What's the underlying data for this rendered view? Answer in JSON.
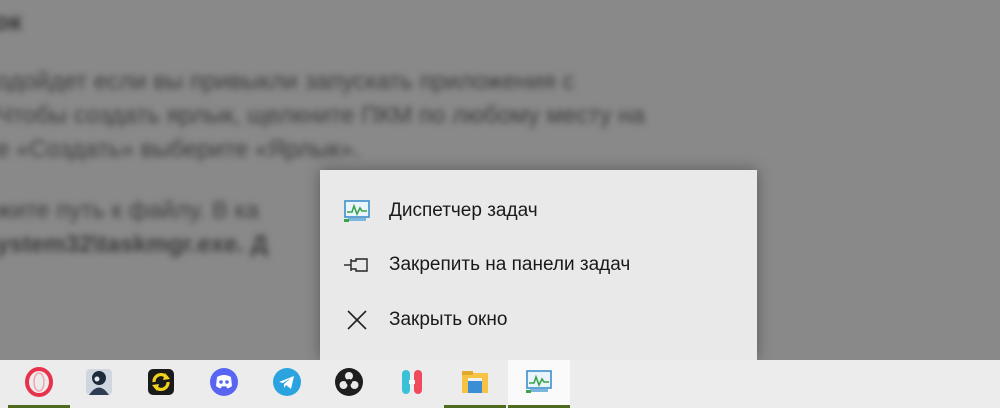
{
  "background_document": {
    "heading": "ок",
    "lines": [
      "одойдет если вы привыкли запускать приложения с",
      "Чтобы создать ярлык, щелкните ПКМ по любому месту на",
      "е «Создать» выберите «Ярлык».",
      "жите путь к файлу. В ка",
      "ystem32\\taskmgr.exe. Д"
    ]
  },
  "jump_list": {
    "items": [
      {
        "label": "Диспетчер задач",
        "icon": "task-manager-icon"
      },
      {
        "label": "Закрепить на панели задач",
        "icon": "pin-icon"
      },
      {
        "label": "Закрыть окно",
        "icon": "close-icon"
      }
    ]
  },
  "taskbar": {
    "apps": [
      {
        "icon": "opera-gx-icon",
        "running": true,
        "active": false,
        "color": "#e8314a"
      },
      {
        "icon": "game-avatar-icon",
        "running": false,
        "active": false,
        "color": "#1c2a3a"
      },
      {
        "icon": "yellow-sync-app-icon",
        "running": false,
        "active": false,
        "color": "#f2d21b"
      },
      {
        "icon": "discord-icon",
        "running": false,
        "active": false,
        "color": "#5865f2"
      },
      {
        "icon": "telegram-icon",
        "running": false,
        "active": false,
        "color": "#2aa3df"
      },
      {
        "icon": "obs-studio-icon",
        "running": false,
        "active": false,
        "color": "#1e1e1e"
      },
      {
        "icon": "mi-fitness-app-icon",
        "running": false,
        "active": false,
        "color": "#ee4a5b"
      },
      {
        "icon": "file-explorer-icon",
        "running": true,
        "active": false,
        "color": "#f6c343"
      },
      {
        "icon": "task-manager-icon",
        "running": true,
        "active": true,
        "color": "#4aa3d8"
      }
    ]
  }
}
